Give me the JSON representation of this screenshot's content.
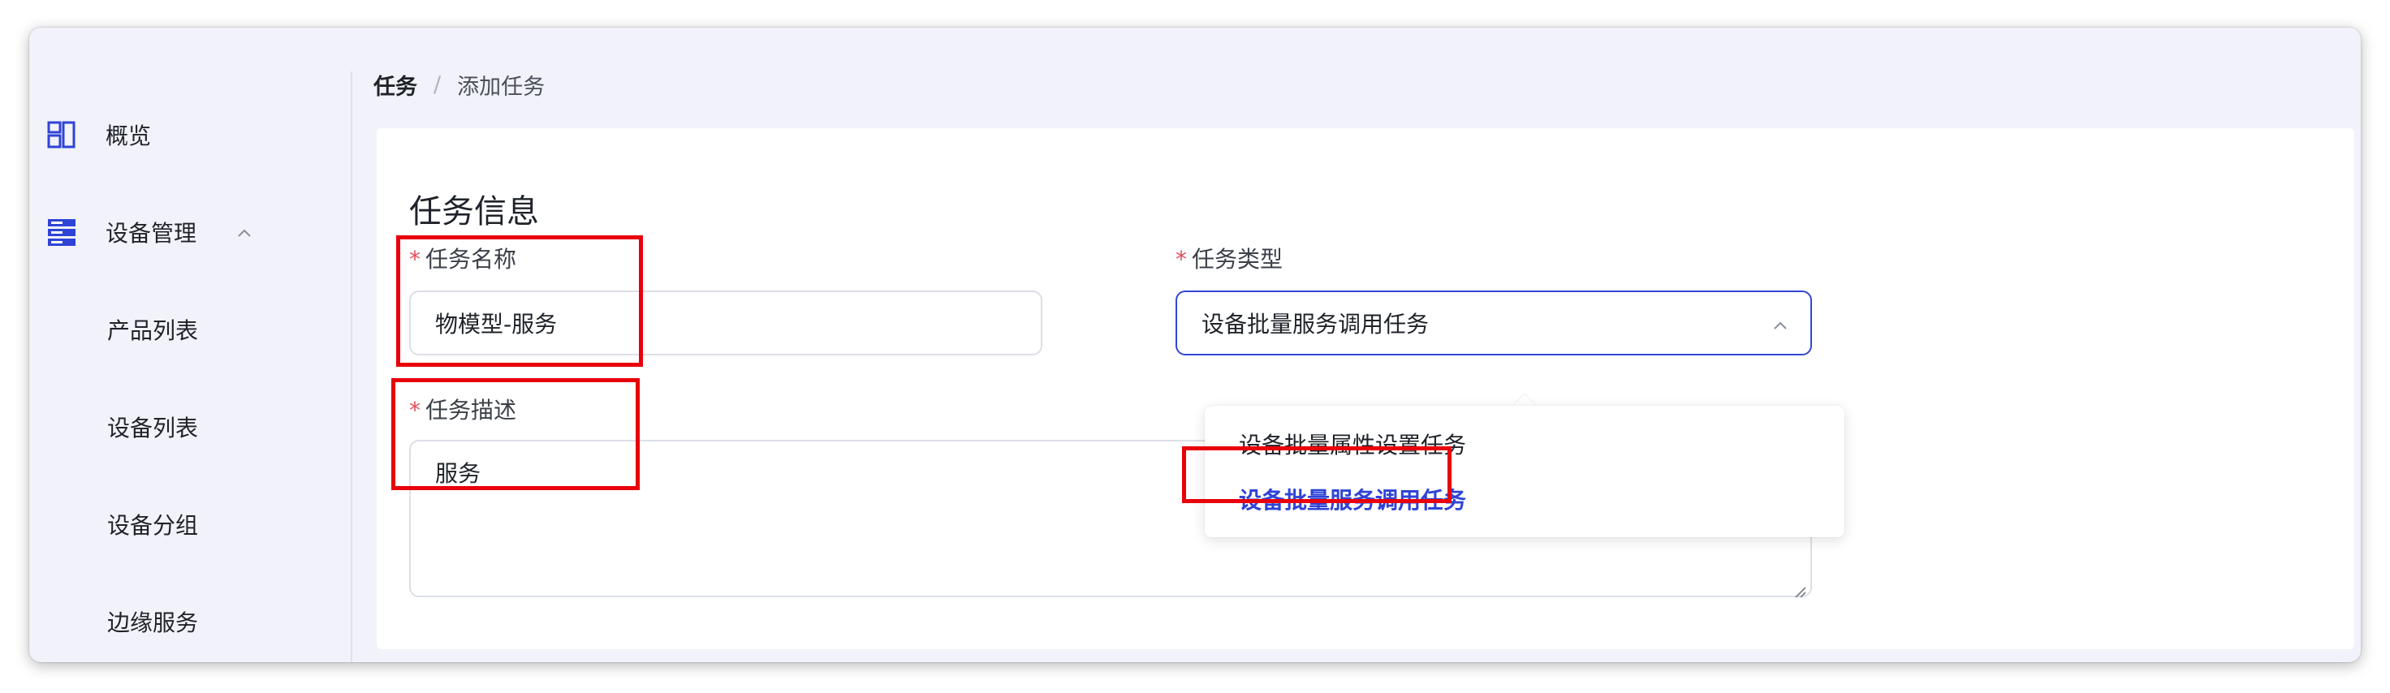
{
  "sidebar": {
    "items": [
      {
        "label": "概览",
        "icon": "layout-icon"
      },
      {
        "label": "设备管理",
        "icon": "server-icon",
        "expanded": true
      },
      {
        "label": "产品列表"
      },
      {
        "label": "设备列表"
      },
      {
        "label": "设备分组"
      },
      {
        "label": "边缘服务"
      }
    ]
  },
  "breadcrumb": {
    "current": "任务",
    "separator": "/",
    "page": "添加任务"
  },
  "form": {
    "section_title": "任务信息",
    "required_mark": "*",
    "task_name": {
      "label": "任务名称",
      "value": "物模型-服务"
    },
    "task_type": {
      "label": "任务类型",
      "value": "设备批量服务调用任务"
    },
    "task_desc": {
      "label": "任务描述",
      "value": "服务"
    }
  },
  "dropdown": {
    "options": [
      {
        "label": "设备批量属性设置任务",
        "selected": false
      },
      {
        "label": "设备批量服务调用任务",
        "selected": true
      }
    ]
  },
  "colors": {
    "accent": "#3247d8",
    "required": "#e34d59",
    "annotation": "#e8000b",
    "background": "#f1f2fa"
  }
}
